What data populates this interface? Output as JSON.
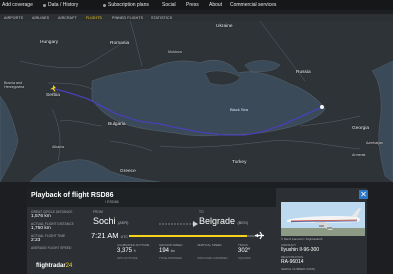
{
  "topnav": {
    "items": [
      "Add coverage",
      "Data / History",
      "Subscription plans",
      "Social",
      "Press",
      "About",
      "Commercial services"
    ]
  },
  "subnav": {
    "items": [
      "AIRPORTS",
      "AIRLINES",
      "AIRCRAFT",
      "FLIGHTS",
      "PINNED FLIGHTS",
      "STATISTICS"
    ],
    "active": "FLIGHTS"
  },
  "map": {
    "labels": {
      "hungary": "Hungary",
      "romania": "Romania",
      "moldova": "Moldova",
      "ukraine": "Ukraine",
      "bosnia": "Bosnia and\nHerzegovina",
      "serbia": "Serbia",
      "bulgaria": "Bulgaria",
      "albania": "Albania",
      "turkey": "Turkey",
      "russia": "Russia",
      "georgia": "Georgia",
      "armenia": "Armenia",
      "azerbaijan": "Azerbaijan",
      "sea": "Black Sea",
      "greece": "Greece"
    },
    "colors": {
      "route": "#4a3fb5",
      "land": "#2c3136",
      "sea": "#3a4a5a"
    }
  },
  "panel": {
    "title": "Playback of flight RSD86",
    "subtitle": "/ RSD86",
    "great_circle_label": "GREAT CIRCLE DISTANCE",
    "great_circle_value": "1,576 km",
    "actual_label": "ACTUAL FLIGHT DISTANCE",
    "actual_value": "1,750 km",
    "flight_time_label": "ACTUAL FLIGHT TIME",
    "flight_time_value": "2:23",
    "avg_speed_label": "AVERAGE FLIGHT SPEED",
    "avg_speed_value": "",
    "logo_main": "flightradar",
    "logo_accent": "24",
    "from_label": "FROM",
    "to_label": "TO",
    "from_city": "Sochi",
    "from_code": "(AER)",
    "to_city": "Belgrade",
    "to_code": "(BEG)",
    "time": "7:21 AM",
    "time_code": "UTC",
    "metrics": [
      {
        "label": "CALIBRATED ALTITUDE",
        "value": "3,375",
        "unit": "ft",
        "sub": "GPS ALTITUDE"
      },
      {
        "label": "GROUND SPEED",
        "value": "194",
        "unit": "kts",
        "sub": "TRUE AIRSPEED"
      },
      {
        "label": "VERTICAL SPEED",
        "value": "",
        "unit": "",
        "sub": "INDICATED AIRSPEED"
      },
      {
        "label": "TRACK",
        "value": "302°",
        "unit": "",
        "sub": "SQUAWK"
      }
    ],
    "photo_credit": "© Ramil Ivanovich / Flightradar24",
    "aircraft_label": "AIRCRAFT",
    "aircraft_value": "Ilyushin Il-96-300",
    "reg_label": "REGISTRATION",
    "reg_value": "RA-96014",
    "serial_label": "SERIAL NUMBER (MSN)",
    "serial_value": "",
    "close_glyph": "✕"
  }
}
